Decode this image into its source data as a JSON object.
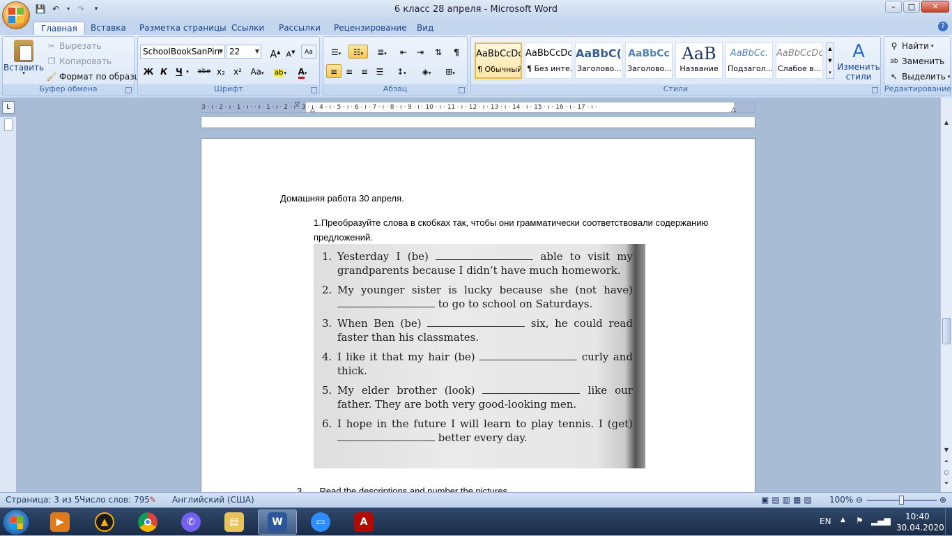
{
  "window": {
    "title": "6 класс 28 апреля - Microsoft Word",
    "controls": {
      "minimize": "–",
      "maximize": "□",
      "close": "✕"
    }
  },
  "qat_icons": [
    "save-icon",
    "undo-icon",
    "redo-icon",
    "customize-icon"
  ],
  "tabs": [
    {
      "label": "Главная",
      "active": true
    },
    {
      "label": "Вставка"
    },
    {
      "label": "Разметка страницы"
    },
    {
      "label": "Ссылки"
    },
    {
      "label": "Рассылки"
    },
    {
      "label": "Рецензирование"
    },
    {
      "label": "Вид"
    }
  ],
  "ribbon": {
    "clipboard": {
      "label": "Буфер обмена",
      "paste": "Вставить",
      "cut": "Вырезать",
      "copy": "Копировать",
      "format_painter": "Формат по образцу"
    },
    "font": {
      "label": "Шрифт",
      "font_name": "SchoolBookSanPin",
      "font_size": "22",
      "bold": "Ж",
      "italic": "К",
      "underline": "Ч",
      "strike": "abe",
      "subscript": "x₂",
      "superscript": "x²",
      "case": "Aa",
      "grow": "A",
      "shrink": "A",
      "font_color_letter": "A",
      "highlight": "ab"
    },
    "paragraph": {
      "label": "Абзац",
      "pilcrow": "¶"
    },
    "styles": {
      "label": "Стили",
      "items": [
        {
          "preview": "AaBbCcDc",
          "name": "¶ Обычный",
          "selected": true
        },
        {
          "preview": "AaBbCcDc",
          "name": "¶ Без инте..."
        },
        {
          "preview": "AaBbC(",
          "name": "Заголово..."
        },
        {
          "preview": "AaBbCc",
          "name": "Заголово..."
        },
        {
          "preview": "AaB",
          "name": "Название"
        },
        {
          "preview": "AaBbCc.",
          "name": "Подзагол..."
        },
        {
          "preview": "AaBbCcDc",
          "name": "Слабое в..."
        }
      ],
      "change_styles_line1": "Изменить",
      "change_styles_line2": "стили"
    },
    "editing": {
      "label": "Редактирование",
      "find": "Найти",
      "replace": "Заменить",
      "select": "Выделить"
    }
  },
  "ruler": {
    "numbers": "3 · ı · 2 · ı · 1 · ı ·   · ı · 1 · ı · 2 · ı · 3 · ı · 4 · ı · 5 · ı · 6 · ı · 7 · ı · 8 · ı · 9 · ı · 10 · ı · 11 · ı · 12 · ı · 13 · ı · 14 · ı · 15 · ı · 16 · ı · 17 · ı ·",
    "tab_selector": "L"
  },
  "document": {
    "heading": "Домашняя работа 30 апреля.",
    "task1": "1.Преобразуйте слова в скобках так, чтобы они грамматически соответствовали содержанию предложений.",
    "exercises": [
      {
        "num": "1.",
        "before": "Yesterday I (be)",
        "after": "able to visit my grandparents because I didn’t have much homework."
      },
      {
        "num": "2.",
        "before": "My younger sister is lucky because she (not have)",
        "after": "to go to school on Saturdays."
      },
      {
        "num": "3.",
        "before": "When Ben (be)",
        "after": "six, he could read faster than his classmates."
      },
      {
        "num": "4.",
        "before": "I like it that my hair (be)",
        "after": "curly and thick."
      },
      {
        "num": "5.",
        "before": "My elder brother (look)",
        "after": "like our father. They are both very good-looking men."
      },
      {
        "num": "6.",
        "before": "I hope in the future I will learn to play tennis. I (get)",
        "after": "better every day."
      }
    ],
    "next_item_num": "3.",
    "next_item_text": "Read the descriptions and number the pictures."
  },
  "status": {
    "page": "Страница: 3 из 5",
    "words": "Число слов: 795",
    "language": "Английский (США)",
    "zoom": "100%",
    "zoom_level": 1.0
  },
  "taskbar": {
    "apps": [
      "media-player-icon",
      "aimp-icon",
      "chrome-icon",
      "viber-icon",
      "file-explorer-icon",
      "word-icon",
      "zoom-icon",
      "acrobat-icon"
    ],
    "lang": "EN",
    "time": "10:40",
    "date": "30.04.2020"
  },
  "colors": {
    "ribbon_text": "#15428b",
    "word_blue": "#2b579a",
    "highlight_yellow": "#f7c74d"
  }
}
